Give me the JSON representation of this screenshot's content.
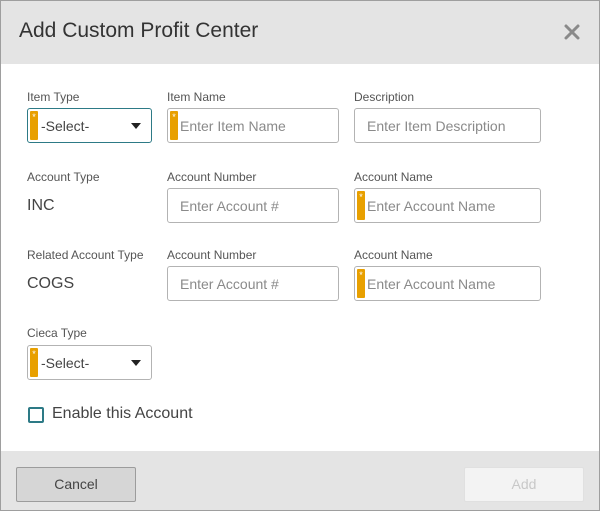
{
  "dialog": {
    "title": "Add Custom Profit Center",
    "close_icon": "close-icon"
  },
  "row1": {
    "item_type_label": "Item Type",
    "item_type_value": "-Select-",
    "item_name_label": "Item Name",
    "item_name_placeholder": "Enter Item Name",
    "description_label": "Description",
    "description_placeholder": "Enter Item Description"
  },
  "row2": {
    "account_type_label": "Account Type",
    "account_type_value": "INC",
    "account_number_label": "Account Number",
    "account_number_placeholder": "Enter Account #",
    "account_name_label": "Account Name",
    "account_name_placeholder": "Enter Account Name"
  },
  "row3": {
    "related_type_label": "Related Account Type",
    "related_type_value": "COGS",
    "account_number_label": "Account Number",
    "account_number_placeholder": "Enter Account #",
    "account_name_label": "Account Name",
    "account_name_placeholder": "Enter Account Name"
  },
  "row4": {
    "cieca_type_label": "Cieca Type",
    "cieca_type_value": "-Select-"
  },
  "enable": {
    "label": "Enable this Account",
    "checked": false
  },
  "footer": {
    "cancel_label": "Cancel",
    "add_label": "Add"
  },
  "required_marker": "*",
  "colors": {
    "header_bg": "#e4e4e4",
    "required_accent": "#e8a000",
    "focus_border": "#2d7a86",
    "disabled_text": "#c8c8c8"
  }
}
